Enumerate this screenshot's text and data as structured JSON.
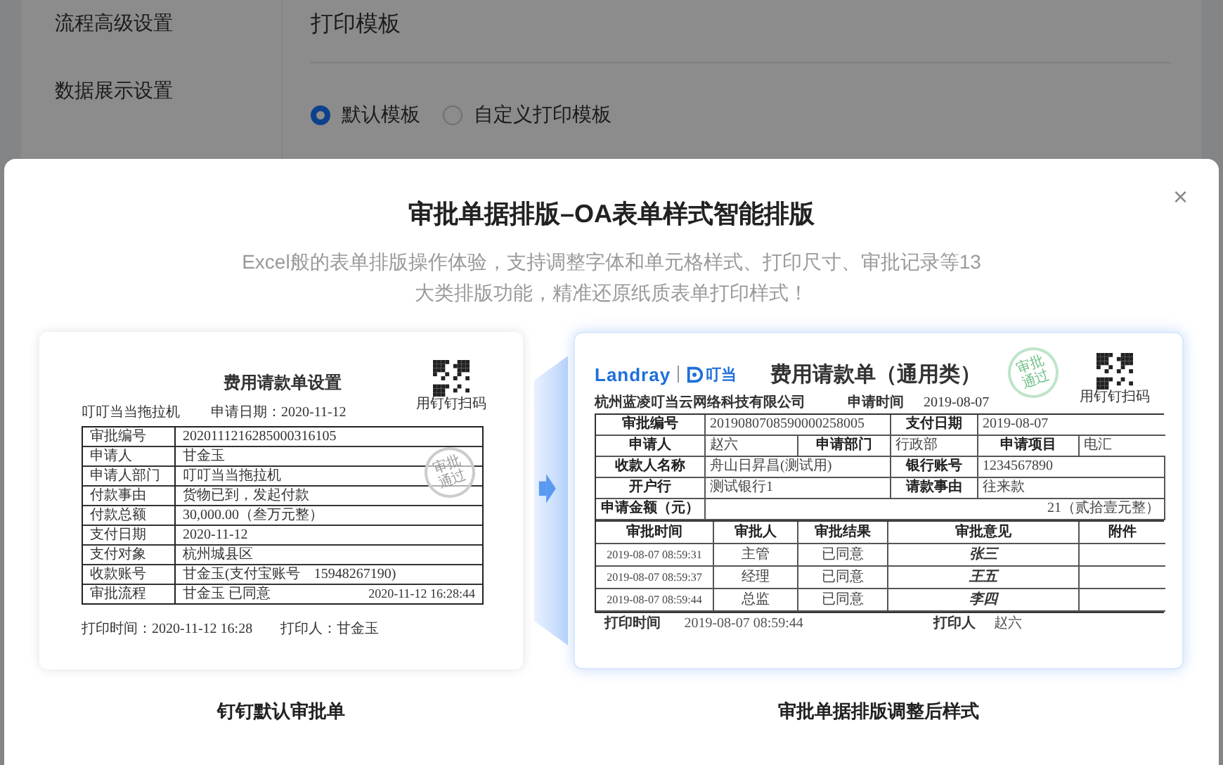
{
  "background": {
    "sidebar": [
      {
        "label": "流程高级设置"
      },
      {
        "label": "数据展示设置"
      }
    ],
    "section_title": "打印模板",
    "radios": [
      {
        "label": "默认模板",
        "selected": true
      },
      {
        "label": "自定义打印模板",
        "selected": false
      }
    ]
  },
  "modal": {
    "title": "审批单据排版–OA表单样式智能排版",
    "close": "×",
    "description_lines": [
      "Excel般的表单排版操作体验，支持调整字体和单元格样式、打印尺寸、审批记录等13",
      "大类排版功能，精准还原纸质表单打印样式！"
    ],
    "default_preview": {
      "title": "费用请款单设置",
      "company": "叮叮当当拖拉机",
      "apply_date": "申请日期：2020-11-12",
      "qr_caption": "用钉钉扫码",
      "stamp": "审批通过",
      "rows": [
        {
          "label": "审批编号",
          "value": "2020111216285000316105"
        },
        {
          "label": "申请人",
          "value": "甘金玉"
        },
        {
          "label": "申请人部门",
          "value": "叮叮当当拖拉机"
        },
        {
          "label": "付款事由",
          "value": "货物已到，发起付款"
        },
        {
          "label": "付款总额",
          "value": "30,000.00（叁万元整）"
        },
        {
          "label": "支付日期",
          "value": "2020-11-12"
        },
        {
          "label": "支付对象",
          "value": "杭州城县区"
        },
        {
          "label": "收款账号",
          "value": "甘金玉(支付宝账号　15948267190)"
        },
        {
          "label": "审批流程",
          "value": "甘金玉 已同意",
          "time": "2020-11-12 16:28:44"
        }
      ],
      "print_time": "打印时间：2020-11-12 16:28",
      "printer": "打印人：甘金玉",
      "caption": "钉钉默认审批单"
    },
    "custom_preview": {
      "brand": "Landray",
      "brand_sub": "叮当",
      "title": "费用请款单（通用类）",
      "company": "杭州蓝凌叮当云网络科技有限公司",
      "apply_time_label": "申请时间",
      "apply_time": "2019-08-07",
      "qr_caption": "用钉钉扫码",
      "stamp": "审批通过",
      "info_rows": [
        [
          "审批编号",
          "2019080708590000258005",
          "支付日期",
          "2019-08-07"
        ],
        [
          "申请人",
          "赵六",
          "申请部门",
          "行政部",
          "申请项目",
          "电汇"
        ],
        [
          "收款人名称",
          "舟山日昇昌(测试用)",
          "银行账号",
          "1234567890"
        ],
        [
          "开户行",
          "测试银行1",
          "请款事由",
          "往来款"
        ],
        [
          "申请金额（元）",
          "21（贰拾壹元整）"
        ]
      ],
      "approval_columns": [
        "审批时间",
        "审批人",
        "审批结果",
        "审批意见",
        "附件"
      ],
      "approval_rows": [
        [
          "2019-08-07 08:59:31",
          "主管",
          "已同意",
          "张三"
        ],
        [
          "2019-08-07 08:59:37",
          "经理",
          "已同意",
          "王五"
        ],
        [
          "2019-08-07 08:59:44",
          "总监",
          "已同意",
          "李四"
        ]
      ],
      "print_time_label": "打印时间",
      "print_time": "2019-08-07 08:59:44",
      "printer_label": "打印人",
      "printer": "赵六",
      "caption": "审批单据排版调整后样式"
    }
  }
}
